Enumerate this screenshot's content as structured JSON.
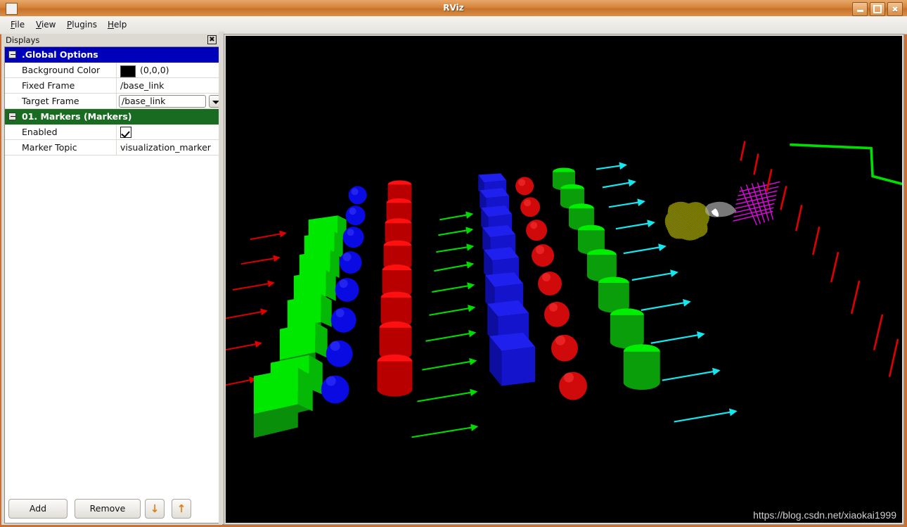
{
  "window": {
    "title": "RViz",
    "controls": {
      "minimize": "minimize-icon",
      "maximize": "maximize-icon",
      "close": "close-icon"
    }
  },
  "menubar": {
    "items": [
      {
        "label": "File",
        "mnemonic": "F"
      },
      {
        "label": "View",
        "mnemonic": "V"
      },
      {
        "label": "Plugins",
        "mnemonic": "P"
      },
      {
        "label": "Help",
        "mnemonic": "H"
      }
    ]
  },
  "displays_panel": {
    "title": "Displays",
    "close_glyph": "☒",
    "groups": [
      {
        "label": ".Global Options",
        "color": "#0000bb",
        "expanded": true,
        "properties": [
          {
            "name": "Background Color",
            "type": "color",
            "swatch": "#000000",
            "value": "(0,0,0)"
          },
          {
            "name": "Fixed Frame",
            "type": "text",
            "value": "/base_link"
          },
          {
            "name": "Target Frame",
            "type": "combo",
            "value": "/base_link"
          }
        ]
      },
      {
        "label": "01. Markers (Markers)",
        "color": "#1a6b22",
        "expanded": true,
        "properties": [
          {
            "name": "Enabled",
            "type": "checkbox",
            "checked": true
          },
          {
            "name": "Marker Topic",
            "type": "text",
            "value": "visualization_marker"
          }
        ]
      }
    ],
    "buttons": {
      "add": "Add",
      "remove": "Remove",
      "move_down": "↓",
      "move_up": "↑"
    }
  },
  "render_view": {
    "background": "#000000",
    "watermark": "https://blog.csdn.net/xiaokai1999",
    "marker_rows": [
      {
        "name": "arrow-row-red",
        "type": "arrow",
        "color": "#d50000"
      },
      {
        "name": "cube-row-green",
        "type": "cube",
        "color": "#00e000"
      },
      {
        "name": "sphere-row-blue",
        "type": "sphere",
        "color": "#0000e8"
      },
      {
        "name": "cylinder-row-red",
        "type": "cylinder",
        "color": "#e00000"
      },
      {
        "name": "arrow-row-green",
        "type": "arrow",
        "color": "#00d000"
      },
      {
        "name": "cube-row-blue",
        "type": "cube",
        "color": "#0000d8"
      },
      {
        "name": "sphere-row-red",
        "type": "sphere",
        "color": "#d00000"
      },
      {
        "name": "cylinder-row-green",
        "type": "cylinder",
        "color": "#00c000"
      },
      {
        "name": "arrow-row-cyan",
        "type": "arrow",
        "color": "#00e5ee"
      },
      {
        "name": "points-yellow",
        "type": "points",
        "color": "#e8e000"
      },
      {
        "name": "points-white",
        "type": "points",
        "color": "#f0f0f0"
      },
      {
        "name": "line-list-magenta",
        "type": "line_list",
        "color": "#e000e0"
      },
      {
        "name": "arrow-row-red-far",
        "type": "arrow",
        "color": "#e00000"
      },
      {
        "name": "line-strip-green",
        "type": "line_strip",
        "color": "#00e000"
      }
    ]
  }
}
